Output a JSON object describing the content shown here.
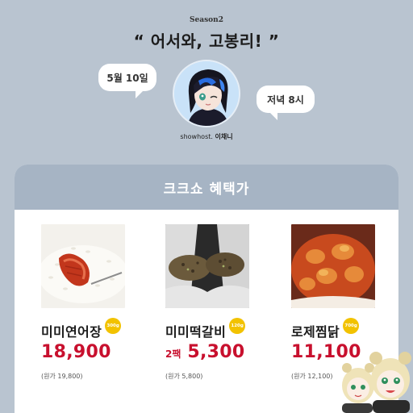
{
  "header": {
    "season": "Season2",
    "headline": "“ 어서와, 고봉리! ”"
  },
  "bubbles": {
    "date": "5월 10일",
    "time": "저녁 8시"
  },
  "host": {
    "label": "showhost.",
    "name": "이채니"
  },
  "panel": {
    "title": "크크쇼 혜택가"
  },
  "products": [
    {
      "name": "미미연어장",
      "weight": "300g",
      "pack": "",
      "price": "18,900",
      "original": "(원가 19,800)"
    },
    {
      "name": "미미떡갈비",
      "weight": "120g",
      "pack": "2팩",
      "price": "5,300",
      "original": "(원가 5,800)"
    },
    {
      "name": "로제찜닭",
      "weight": "700g",
      "pack": "",
      "price": "11,100",
      "original": "(원가 12,100)"
    }
  ],
  "colors": {
    "background": "#b9c4d0",
    "panel_header": "#a6b4c4",
    "price": "#c8102e",
    "weight_badge": "#f2c200"
  }
}
